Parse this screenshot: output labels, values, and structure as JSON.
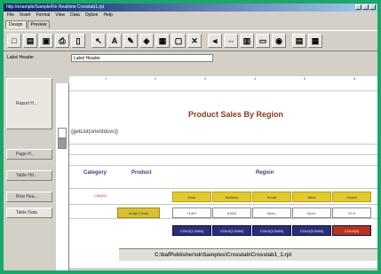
{
  "window": {
    "title": "http://example/Sample/Re Realtime Crosstab1.rpt"
  },
  "menu": [
    "File",
    "Insert",
    "Format",
    "View",
    "Data",
    "Option",
    "Help"
  ],
  "tabs": [
    {
      "label": "Design",
      "active": true
    },
    {
      "label": "Preview",
      "active": false
    }
  ],
  "toolbar": {
    "buttons": [
      {
        "icon": "new-doc-icon",
        "glyph": "□"
      },
      {
        "icon": "open-folder-icon",
        "glyph": "▤"
      },
      {
        "icon": "save-icon",
        "glyph": "▣"
      },
      {
        "icon": "print-icon",
        "glyph": "⎙"
      },
      {
        "icon": "page-icon",
        "glyph": "▯"
      },
      {
        "icon": "cursor-icon",
        "glyph": "↖"
      },
      {
        "icon": "text-icon",
        "glyph": "A"
      },
      {
        "icon": "paint-icon",
        "glyph": "✎"
      },
      {
        "icon": "image-icon",
        "glyph": "◈"
      },
      {
        "icon": "chart-icon",
        "glyph": "▦"
      },
      {
        "icon": "box-icon",
        "glyph": "▢"
      },
      {
        "icon": "delete-icon",
        "glyph": "✕"
      },
      {
        "icon": "align-left-icon",
        "glyph": "⫷"
      },
      {
        "icon": "align-center-icon",
        "glyph": "⇔"
      },
      {
        "icon": "grid-icon",
        "glyph": "▥"
      },
      {
        "icon": "monitor-icon",
        "glyph": "▭"
      },
      {
        "icon": "lock-icon",
        "glyph": "◉"
      },
      {
        "icon": "properties-icon",
        "glyph": "▤"
      },
      {
        "icon": "layout-icon",
        "glyph": "▦"
      }
    ]
  },
  "properties": {
    "label": "Label Header",
    "value": "Label Header"
  },
  "row_labels": [
    {
      "label": "Report H...",
      "active": true
    },
    {
      "label": "Page H...",
      "active": false
    },
    {
      "label": "Table Hd...",
      "active": false
    },
    {
      "label": "Row Hea...",
      "active": false
    },
    {
      "label": "Table Data",
      "active": true
    }
  ],
  "ruler_marks": [
    "1",
    "2",
    "3",
    "4",
    "5",
    "6"
  ],
  "report": {
    "title": "Product Sales By Region",
    "param_expression": "{getList(orientdsvs)}",
    "headers": {
      "category": "Category",
      "product": "Product",
      "region": "Region"
    },
    "category_value": "CIB(28)",
    "product_value": "Ab3(0,T2dd)",
    "region_headers": [
      "East",
      "Midwest",
      "South",
      "West",
      "Grand"
    ],
    "region_values": [
      "?1307",
      "5,824",
      "NULL",
      "NULL",
      "22.0"
    ],
    "totals": [
      "COLG(1,SUM)",
      "COLG(2,SUM)",
      "COLG(3,SUM)",
      "COLG(5,SUM)",
      "COLG(6)"
    ],
    "footer_path": "C:\\bafPublisher\\ok\\Samples\\Crosstab\\Crosstab1_1.rpt"
  },
  "colors": {
    "title_bar": "#0a246a",
    "region_header": "#e3c92a",
    "total_cells": "#2a2e7a",
    "accent_red": "#b8321a"
  }
}
